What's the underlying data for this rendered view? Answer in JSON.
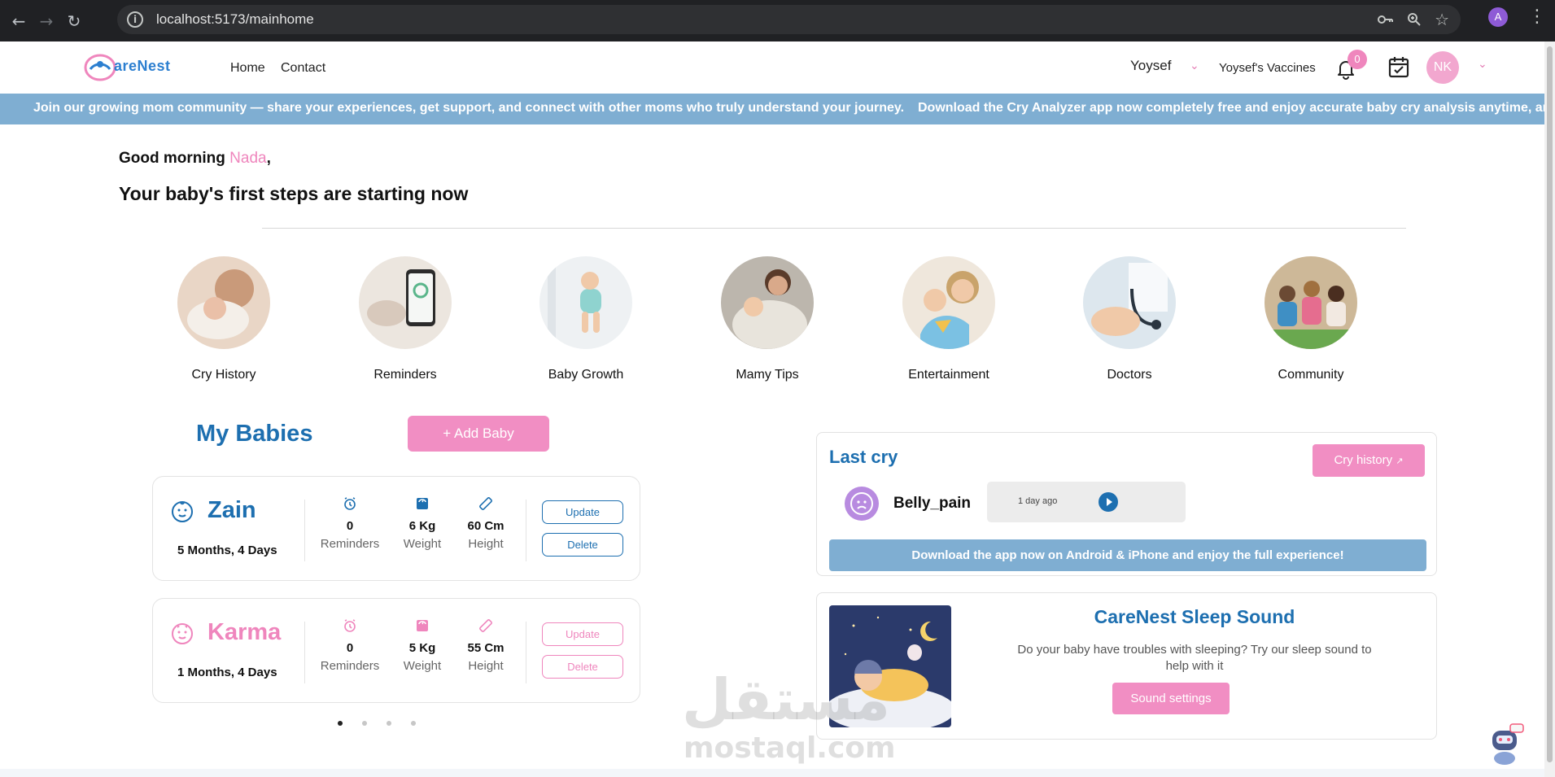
{
  "browser": {
    "url": "localhost:5173/mainhome",
    "profile_initial": "A",
    "icons": [
      "back-arrow-icon",
      "forward-arrow-icon",
      "reload-icon",
      "site-info-icon",
      "key-icon",
      "zoom-icon",
      "star-icon",
      "menu-icon"
    ]
  },
  "header": {
    "logo_text": "areNest",
    "nav": [
      "Home",
      "Contact"
    ],
    "user_select": "Yoysef",
    "vaccines_link": "Yoysef's Vaccines",
    "notification_count": "0",
    "avatar_initials": "NK"
  },
  "marquee": [
    "Join our growing mom community — share your experiences, get support, and connect with other moms who truly understand your journey.",
    "Download the Cry Analyzer app now completely free and enjoy accurate baby cry analysis anytime, anywhere"
  ],
  "greeting": {
    "prefix": "Good morning",
    "name": "Nada",
    "suffix": ",",
    "subtitle": "Your baby's first steps are starting now"
  },
  "features": [
    {
      "label": "Cry History"
    },
    {
      "label": "Reminders"
    },
    {
      "label": "Baby Growth"
    },
    {
      "label": "Mamy Tips"
    },
    {
      "label": "Entertainment"
    },
    {
      "label": "Doctors"
    },
    {
      "label": "Community"
    }
  ],
  "babies": {
    "title": "My Babies",
    "add_label": "+  Add Baby",
    "list": [
      {
        "name": "Zain",
        "age": "5 Months, 4 Days",
        "reminders": "0",
        "weight": "6 Kg",
        "height": "60 Cm",
        "accent": "#1d6fb0"
      },
      {
        "name": "Karma",
        "age": "1 Months, 4 Days",
        "reminders": "0",
        "weight": "5 Kg",
        "height": "55 Cm",
        "accent": "#ef86bd"
      }
    ],
    "stat_labels": {
      "reminders": "Reminders",
      "weight": "Weight",
      "height": "Height"
    },
    "update_label": "Update",
    "delete_label": "Delete"
  },
  "last_cry": {
    "title": "Last cry",
    "history_button": "Cry history",
    "cry_type": "Belly_pain",
    "time_ago": "1 day ago",
    "download_banner": "Download the app now on Android & iPhone and enjoy the full experience!"
  },
  "sleep_sound": {
    "title": "CareNest Sleep Sound",
    "description": "Do your baby have troubles with sleeping? Try our sleep sound to help with it",
    "button": "Sound settings"
  },
  "watermark": {
    "arabic": "مستقل",
    "latin": "mostaql.com"
  },
  "colors": {
    "primary": "#1d6fb0",
    "pink": "#f18ec3",
    "banner": "#7faed2"
  }
}
